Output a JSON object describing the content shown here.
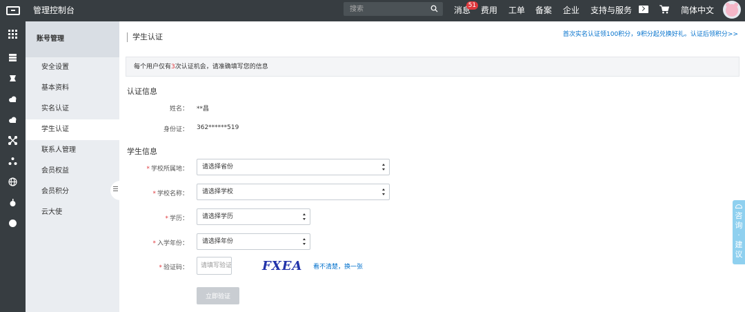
{
  "topbar": {
    "app_title": "管理控制台",
    "search_placeholder": "搜索",
    "nav": {
      "messages": "消息",
      "messages_badge": "51",
      "billing": "费用",
      "tickets": "工单",
      "filing": "备案",
      "enterprise": "企业",
      "support": "支持与服务",
      "language": "简体中文"
    }
  },
  "sidebar": {
    "title": "账号管理",
    "items": [
      {
        "label": "安全设置"
      },
      {
        "label": "基本资料"
      },
      {
        "label": "实名认证"
      },
      {
        "label": "学生认证",
        "active": true
      },
      {
        "label": "联系人管理"
      },
      {
        "label": "会员权益"
      },
      {
        "label": "会员积分"
      },
      {
        "label": "云大使"
      }
    ]
  },
  "main": {
    "page_title": "学生认证",
    "promo_link": "首次实名认证领100积分，9积分起兑换好礼。认证后领积分>>",
    "notice": {
      "prefix": "每个用户仅有",
      "highlight": "3",
      "suffix": "次认证机会，请准确填写您的信息"
    },
    "auth_section": {
      "title": "认证信息",
      "name_label": "姓名：",
      "name_value": "**昌",
      "id_label": "身份证：",
      "id_value": "362******519"
    },
    "student_section": {
      "title": "学生信息",
      "required_mark": "*",
      "school_region_label": "学校所属地：",
      "school_region_placeholder": "请选择省份",
      "school_name_label": "学校名称：",
      "school_name_placeholder": "请选择学校",
      "education_label": "学历：",
      "education_placeholder": "请选择学历",
      "enroll_year_label": "入学年份：",
      "enroll_year_placeholder": "请选择年份",
      "captcha_label": "验证码：",
      "captcha_placeholder": "请填写验证码",
      "captcha_text": "FXEA",
      "captcha_refresh": "看不清楚，换一张",
      "submit": "立即验证"
    }
  },
  "feedback_tab": {
    "text": "咨询·建议"
  },
  "colors": {
    "topbar_bg": "#373d41",
    "sidebar_bg": "#eaedf1",
    "link": "#0070cc",
    "required": "#e0393e",
    "feedback_bg": "#8fd0ef"
  }
}
